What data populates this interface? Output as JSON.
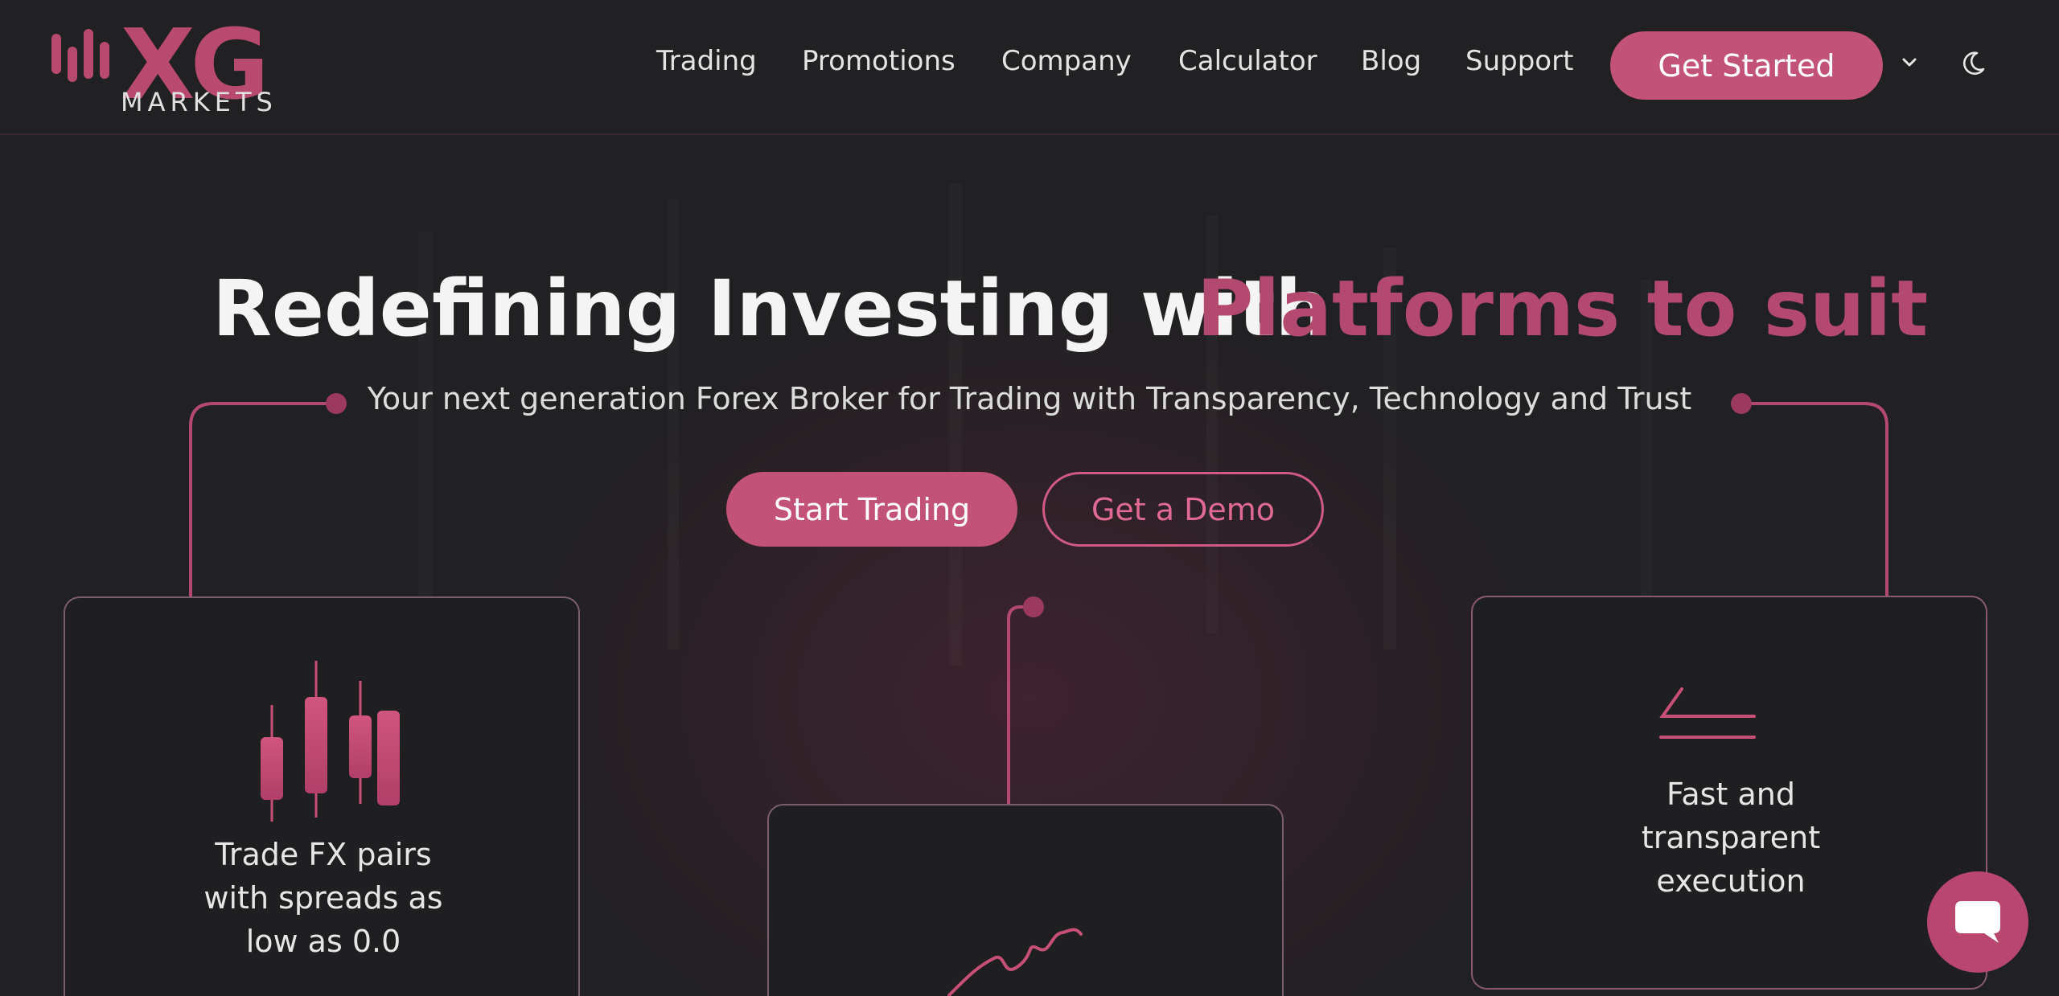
{
  "header": {
    "logo": {
      "text": "XG",
      "subtext": "MARKETS"
    },
    "nav": [
      "Trading",
      "Promotions",
      "Company",
      "Calculator",
      "Blog",
      "Support"
    ],
    "cta_label": "Get Started",
    "dropdown_icon": "chevron-down-icon",
    "theme_icon": "moon-icon"
  },
  "hero": {
    "title_white": "Redefining Investing with",
    "title_pink": "Platforms to suit",
    "subtitle": "Your next generation Forex Broker for Trading with Transparency, Technology and Trust",
    "primary_button": "Start Trading",
    "secondary_button": "Get a Demo"
  },
  "cards": [
    {
      "icon": "candlestick-icon",
      "text": "Trade FX pairs with spreads as low as 0.0"
    },
    {
      "icon": "line-chart-icon",
      "text": ""
    },
    {
      "icon": "speed-lines-icon",
      "text": "Fast and transparent execution"
    }
  ],
  "chat": {
    "icon": "chat-bubble-icon"
  },
  "colors": {
    "accent": "#c25277",
    "accent_text": "#b4496f",
    "background": "#212022"
  }
}
